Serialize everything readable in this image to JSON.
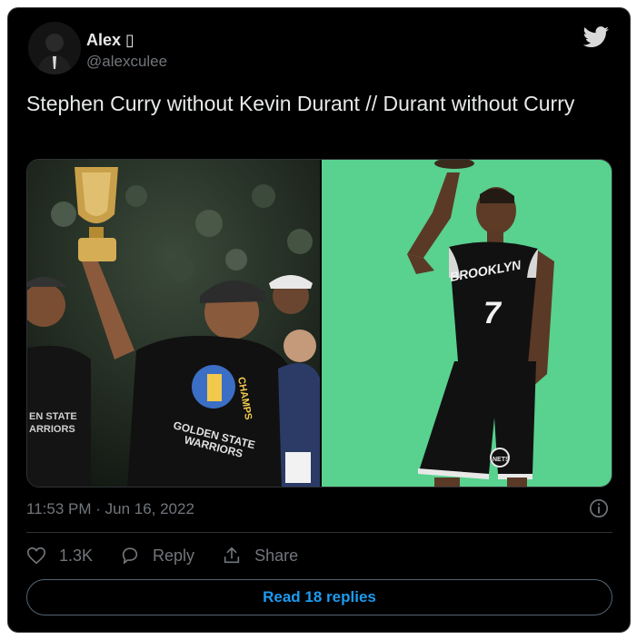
{
  "author": {
    "display_name": "Alex ▯",
    "handle": "@alexculee"
  },
  "tweet": {
    "text": "Stephen Curry without Kevin Durant // Durant without Curry",
    "timestamp": "11:53 PM · Jun 16, 2022"
  },
  "media": {
    "left_photo": {
      "jersey_text": "GOLDEN STATE WARRIORS",
      "jersey_side_text": "EN STATE ARRIORS",
      "champs_text": "CHAMPS"
    },
    "right_photo": {
      "jersey_text": "BROOKLYN",
      "jersey_number": "7",
      "shorts_logo": "NETS"
    }
  },
  "actions": {
    "likes_count": "1.3K",
    "reply_label": "Reply",
    "share_label": "Share"
  },
  "read_replies_label": "Read 18 replies",
  "colors": {
    "background": "#000000",
    "accent": "#1d9bf0",
    "muted": "#71767b",
    "text": "#e7e9ea"
  },
  "icons": [
    "twitter-bird-icon",
    "info-icon",
    "heart-icon",
    "reply-icon",
    "share-icon"
  ]
}
